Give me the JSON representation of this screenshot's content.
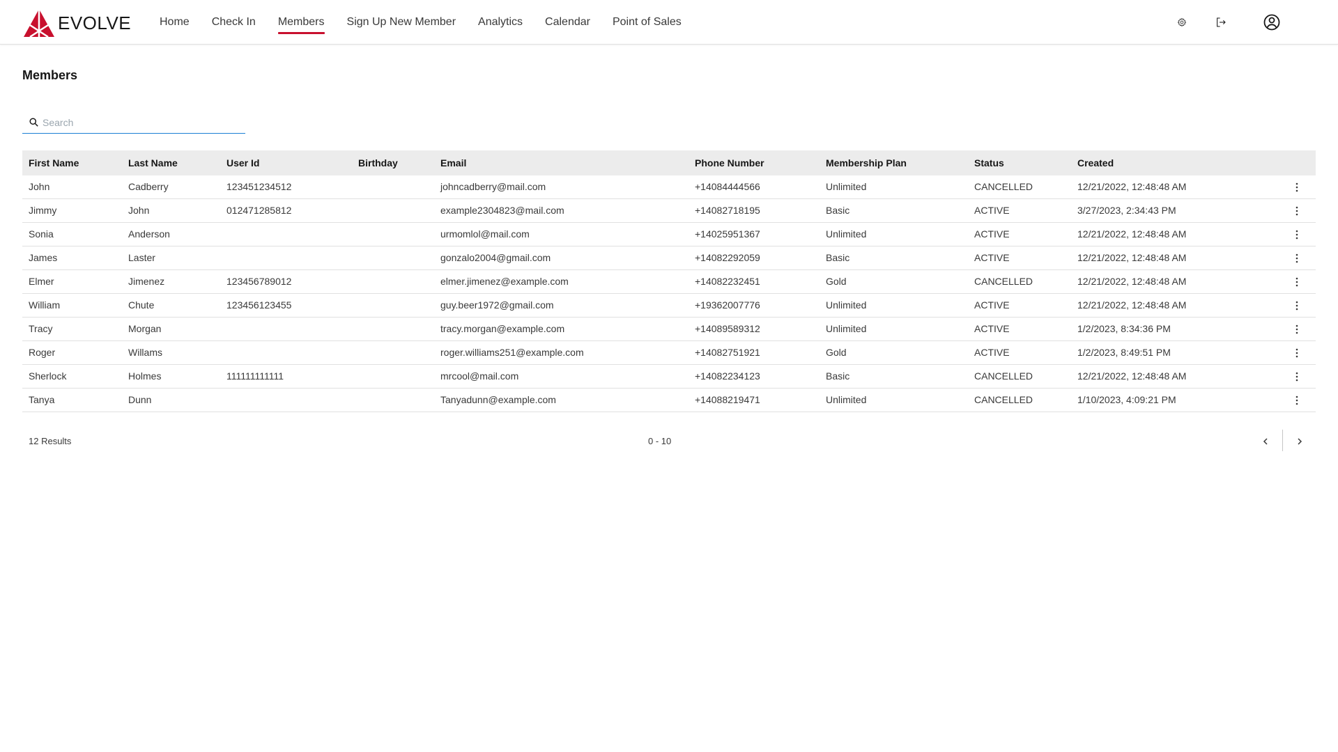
{
  "app": {
    "brand": "EVOLVE",
    "brand_color": "#c8102e",
    "accent_color": "#1a7fd4"
  },
  "nav": {
    "items": [
      {
        "label": "Home",
        "active": false
      },
      {
        "label": "Check In",
        "active": false
      },
      {
        "label": "Members",
        "active": true
      },
      {
        "label": "Sign Up New Member",
        "active": false
      },
      {
        "label": "Analytics",
        "active": false
      },
      {
        "label": "Calendar",
        "active": false
      },
      {
        "label": "Point of Sales",
        "active": false
      }
    ],
    "icons": [
      "settings-icon",
      "logout-icon",
      "user-avatar-icon"
    ]
  },
  "page": {
    "title": "Members",
    "search": {
      "placeholder": "Search",
      "value": ""
    }
  },
  "table": {
    "columns": [
      "First Name",
      "Last Name",
      "User Id",
      "Birthday",
      "Email",
      "Phone Number",
      "Membership Plan",
      "Status",
      "Created"
    ],
    "rows": [
      {
        "first": "John",
        "last": "Cadberry",
        "user_id": "123451234512",
        "birthday": "",
        "email": "johncadberry@mail.com",
        "phone": "+14084444566",
        "plan": "Unlimited",
        "status": "CANCELLED",
        "created": "12/21/2022, 12:48:48 AM"
      },
      {
        "first": "Jimmy",
        "last": "John",
        "user_id": "012471285812",
        "birthday": "",
        "email": "example2304823@mail.com",
        "phone": "+14082718195",
        "plan": "Basic",
        "status": "ACTIVE",
        "created": "3/27/2023, 2:34:43 PM"
      },
      {
        "first": "Sonia",
        "last": "Anderson",
        "user_id": "",
        "birthday": "",
        "email": "urmomlol@mail.com",
        "phone": "+14025951367",
        "plan": "Unlimited",
        "status": "ACTIVE",
        "created": "12/21/2022, 12:48:48 AM"
      },
      {
        "first": "James",
        "last": "Laster",
        "user_id": "",
        "birthday": "",
        "email": "gonzalo2004@gmail.com",
        "phone": "+14082292059",
        "plan": "Basic",
        "status": "ACTIVE",
        "created": "12/21/2022, 12:48:48 AM"
      },
      {
        "first": "Elmer",
        "last": "Jimenez",
        "user_id": "123456789012",
        "birthday": "",
        "email": "elmer.jimenez@example.com",
        "phone": "+14082232451",
        "plan": "Gold",
        "status": "CANCELLED",
        "created": "12/21/2022, 12:48:48 AM"
      },
      {
        "first": "William",
        "last": "Chute",
        "user_id": "123456123455",
        "birthday": "",
        "email": "guy.beer1972@gmail.com",
        "phone": "+19362007776",
        "plan": "Unlimited",
        "status": "ACTIVE",
        "created": "12/21/2022, 12:48:48 AM"
      },
      {
        "first": "Tracy",
        "last": "Morgan",
        "user_id": "",
        "birthday": "",
        "email": "tracy.morgan@example.com",
        "phone": "+14089589312",
        "plan": "Unlimited",
        "status": "ACTIVE",
        "created": "1/2/2023, 8:34:36 PM"
      },
      {
        "first": "Roger",
        "last": "Willams",
        "user_id": "",
        "birthday": "",
        "email": "roger.williams251@example.com",
        "phone": "+14082751921",
        "plan": "Gold",
        "status": "ACTIVE",
        "created": "1/2/2023, 8:49:51 PM"
      },
      {
        "first": "Sherlock",
        "last": "Holmes",
        "user_id": "111111111111",
        "birthday": "",
        "email": "mrcool@mail.com",
        "phone": "+14082234123",
        "plan": "Basic",
        "status": "CANCELLED",
        "created": "12/21/2022, 12:48:48 AM"
      },
      {
        "first": "Tanya",
        "last": "Dunn",
        "user_id": "",
        "birthday": "",
        "email": "Tanyadunn@example.com",
        "phone": "+14088219471",
        "plan": "Unlimited",
        "status": "CANCELLED",
        "created": "1/10/2023, 4:09:21 PM"
      }
    ]
  },
  "footer": {
    "results": "12 Results",
    "range": "0 - 10"
  }
}
